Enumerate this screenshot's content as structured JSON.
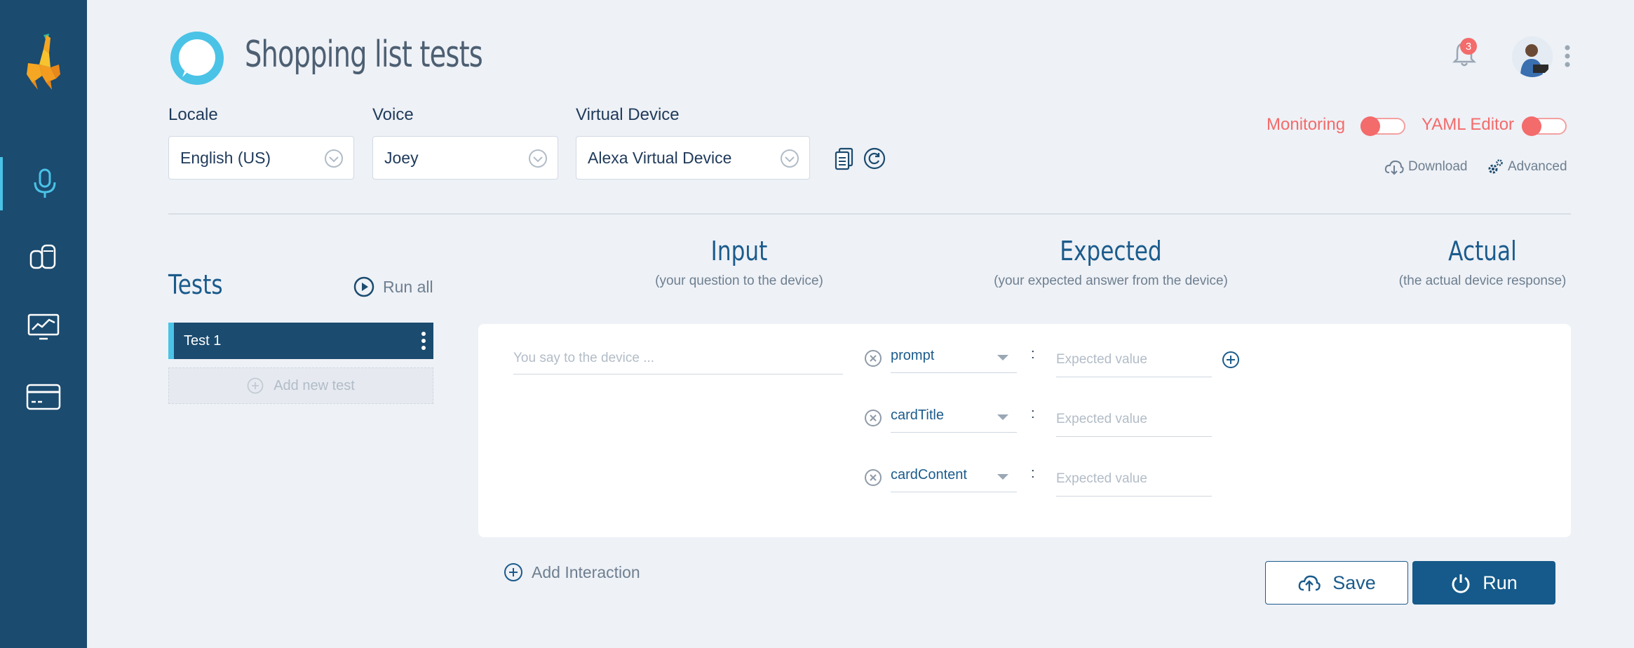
{
  "header": {
    "title": "Shopping list tests",
    "notification_count": "3"
  },
  "config": {
    "locale": {
      "label": "Locale",
      "value": "English (US)"
    },
    "voice": {
      "label": "Voice",
      "value": "Joey"
    },
    "device": {
      "label": "Virtual Device",
      "value": "Alexa Virtual Device"
    },
    "monitoring_label": "Monitoring",
    "yaml_label": "YAML Editor",
    "download_label": "Download",
    "advanced_label": "Advanced"
  },
  "columns": {
    "input": {
      "title": "Input",
      "subtitle": "(your question to the device)"
    },
    "expected": {
      "title": "Expected",
      "subtitle": "(your expected answer from the device)"
    },
    "actual": {
      "title": "Actual",
      "subtitle": "(the actual device response)"
    }
  },
  "tests": {
    "title": "Tests",
    "run_all": "Run all",
    "items": [
      {
        "label": "Test 1"
      }
    ],
    "add_label": "Add new test"
  },
  "interaction": {
    "input_placeholder": "You say to the device ...",
    "expected": [
      {
        "key": "prompt",
        "value_placeholder": "Expected value"
      },
      {
        "key": "cardTitle",
        "value_placeholder": "Expected value"
      },
      {
        "key": "cardContent",
        "value_placeholder": "Expected value"
      }
    ],
    "add_label": "Add Interaction"
  },
  "actions": {
    "save": "Save",
    "run": "Run"
  },
  "colors": {
    "sidebar": "#1b4b6f",
    "accent": "#4ac3e6",
    "primary": "#155a8a",
    "danger": "#f36b6b"
  }
}
